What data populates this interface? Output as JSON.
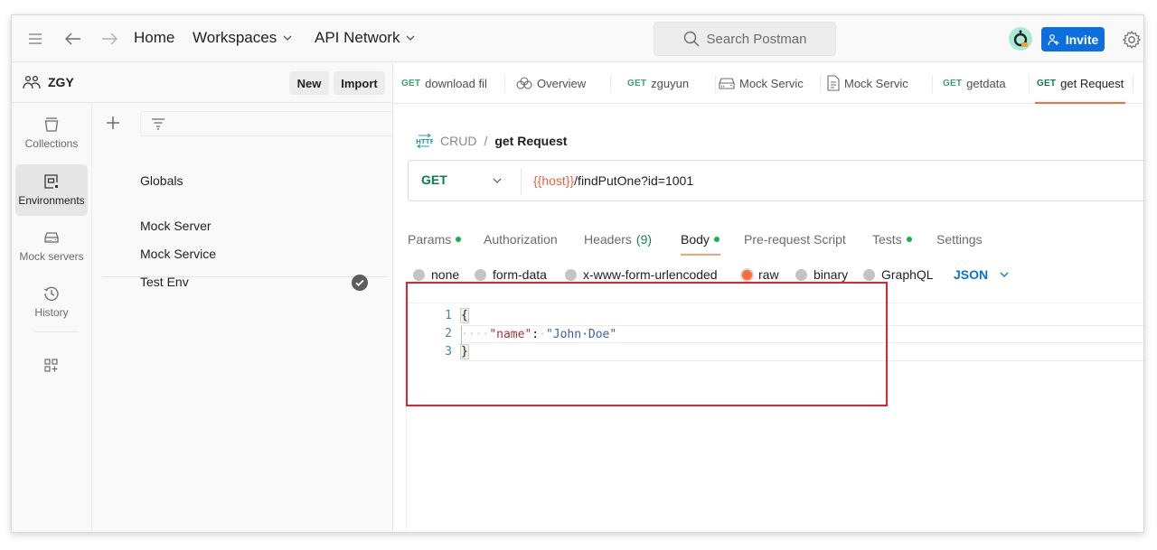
{
  "header": {
    "nav": {
      "home": "Home",
      "workspaces": "Workspaces",
      "api_network": "API Network"
    },
    "search_placeholder": "Search Postman",
    "invite_label": "Invite"
  },
  "workspace": {
    "name": "ZGY",
    "new_label": "New",
    "import_label": "Import"
  },
  "rail": {
    "items": [
      {
        "label": "Collections",
        "icon": "collections-icon",
        "active": false
      },
      {
        "label": "Environments",
        "icon": "environments-icon",
        "active": true
      },
      {
        "label": "Mock servers",
        "icon": "mock-servers-icon",
        "active": false
      },
      {
        "label": "History",
        "icon": "history-icon",
        "active": false
      }
    ]
  },
  "environments": {
    "globals": "Globals",
    "items": [
      {
        "name": "Mock Server",
        "active": false
      },
      {
        "name": "Mock Service",
        "active": false
      },
      {
        "name": "Test Env",
        "active": true
      }
    ]
  },
  "tabs": [
    {
      "method": "GET",
      "label": "download fil",
      "type": "request"
    },
    {
      "method": "",
      "label": "Overview",
      "type": "overview"
    },
    {
      "method": "GET",
      "label": "zguyun",
      "type": "request"
    },
    {
      "method": "",
      "label": "Mock Servic",
      "type": "mock-server"
    },
    {
      "method": "",
      "label": "Mock Servic",
      "type": "environment"
    },
    {
      "method": "GET",
      "label": "getdata",
      "type": "request"
    },
    {
      "method": "GET",
      "label": "get Request",
      "type": "request",
      "active": true
    }
  ],
  "request": {
    "breadcrumb": {
      "parent": "CRUD",
      "separator": "/",
      "current": "get Request"
    },
    "method": "GET",
    "url_variable": "{{host}}",
    "url_path": "/findPutOne?id=1001",
    "tabs": [
      {
        "label": "Params",
        "dot": true
      },
      {
        "label": "Authorization",
        "dot": false
      },
      {
        "label": "Headers",
        "count": "(9)",
        "dot": false
      },
      {
        "label": "Body",
        "dot": true,
        "active": true
      },
      {
        "label": "Pre-request Script",
        "dot": false
      },
      {
        "label": "Tests",
        "dot": true
      },
      {
        "label": "Settings",
        "dot": false
      }
    ],
    "body_modes": [
      {
        "label": "none",
        "selected": false
      },
      {
        "label": "form-data",
        "selected": false
      },
      {
        "label": "x-www-form-urlencoded",
        "selected": false
      },
      {
        "label": "raw",
        "selected": true
      },
      {
        "label": "binary",
        "selected": false
      },
      {
        "label": "GraphQL",
        "selected": false
      }
    ],
    "raw_format": "JSON",
    "body_lines": [
      {
        "num": "1",
        "text": "{"
      },
      {
        "num": "2",
        "key": "\"name\"",
        "colon": ":",
        "value": "\"John Doe\""
      },
      {
        "num": "3",
        "text": "}"
      }
    ]
  },
  "colors": {
    "accent": "#ff6c37",
    "invite_button": "#0b6fe0",
    "method_get": "#0a7d4a",
    "status_dot": "#13b24b",
    "url_variable": "#f05f3b",
    "highlight_box": "#e0232e"
  }
}
